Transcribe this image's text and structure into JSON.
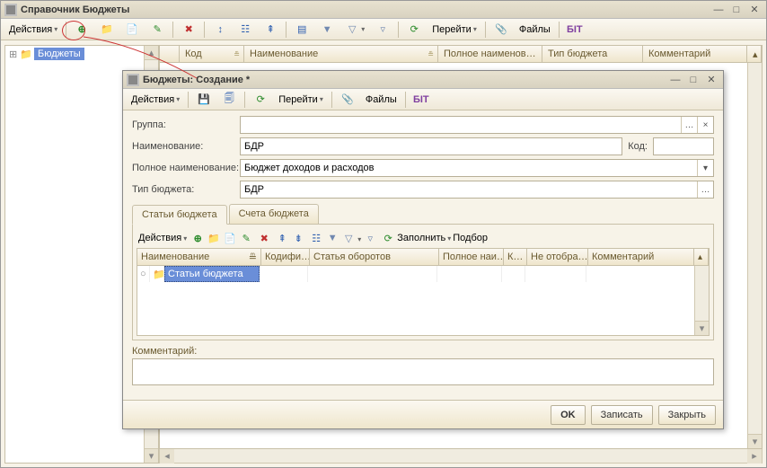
{
  "main_window": {
    "title": "Справочник Бюджеты",
    "toolbar": {
      "actions": "Действия",
      "goto": "Перейти",
      "files": "Файлы"
    },
    "tree": {
      "root": "Бюджеты"
    },
    "columns": {
      "code": "Код",
      "name": "Наименование",
      "full_name": "Полное наименов…",
      "budget_type": "Тип бюджета",
      "comment": "Комментарий"
    }
  },
  "dialog": {
    "title": "Бюджеты: Создание *",
    "toolbar": {
      "actions": "Действия",
      "goto": "Перейти",
      "files": "Файлы"
    },
    "labels": {
      "group": "Группа:",
      "name": "Наименование:",
      "full_name": "Полное наименование:",
      "budget_type": "Тип бюджета:",
      "code": "Код:",
      "comment": "Комментарий:"
    },
    "values": {
      "group": "",
      "name": "БДР",
      "full_name": "Бюджет доходов и расходов",
      "budget_type": "БДР",
      "code": "",
      "comment": ""
    },
    "tabs": {
      "items": "Статьи бюджета",
      "accounts": "Счета бюджета"
    },
    "inner_toolbar": {
      "actions": "Действия",
      "fill": "Заполнить",
      "pick": "Подбор"
    },
    "inner_columns": {
      "name": "Наименование",
      "codif": "Кодифи…",
      "turnover": "Статья оборотов",
      "full": "Полное наи…",
      "k": "К…",
      "no_disp": "Не отобра…",
      "comment": "Комментарий"
    },
    "inner_rows": [
      {
        "name": "Статьи бюджета"
      }
    ],
    "footer": {
      "ok": "OK",
      "save": "Записать",
      "close": "Закрыть"
    }
  }
}
